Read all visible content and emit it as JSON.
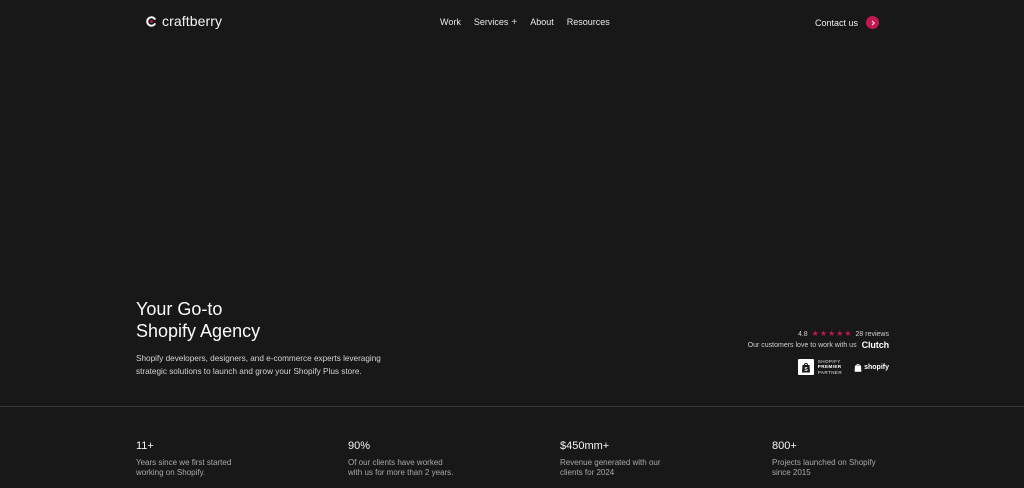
{
  "header": {
    "logo_text": "craftberry",
    "nav": [
      {
        "label": "Work"
      },
      {
        "label": "Services"
      },
      {
        "label": "About"
      },
      {
        "label": "Resources"
      }
    ],
    "contact_label": "Contact us"
  },
  "hero": {
    "title_line1": "Your Go-to",
    "title_line2": "Shopify Agency",
    "desc_line1": "Shopify developers, designers, and e-commerce experts leveraging",
    "desc_line2": "strategic solutions to launch and grow your Shopify Plus store."
  },
  "rating": {
    "score": "4.8",
    "stars": 5,
    "reviews": "28 reviews",
    "tagline": "Our customers love to work with us",
    "platform": "Clutch"
  },
  "badges": {
    "premier_line1": "SHOPIFY",
    "premier_line2": "PREMIER",
    "premier_line3": "PARTNER",
    "shopify_word": "shopify"
  },
  "stats": [
    {
      "value": "11+",
      "desc_line1": "Years since we first started",
      "desc_line2": "working on Shopify."
    },
    {
      "value": "90%",
      "desc_line1": "Of our clients have worked",
      "desc_line2": "with us for more than 2 years."
    },
    {
      "value": "$450mm+",
      "desc_line1": "Revenue generated with our",
      "desc_line2": "clients for 2024"
    },
    {
      "value": "800+",
      "desc_line1": "Projects launched on Shopify",
      "desc_line2": "since 2015"
    }
  ],
  "colors": {
    "background": "#181818",
    "accent": "#c4164f",
    "divider": "#3a3a3a"
  }
}
